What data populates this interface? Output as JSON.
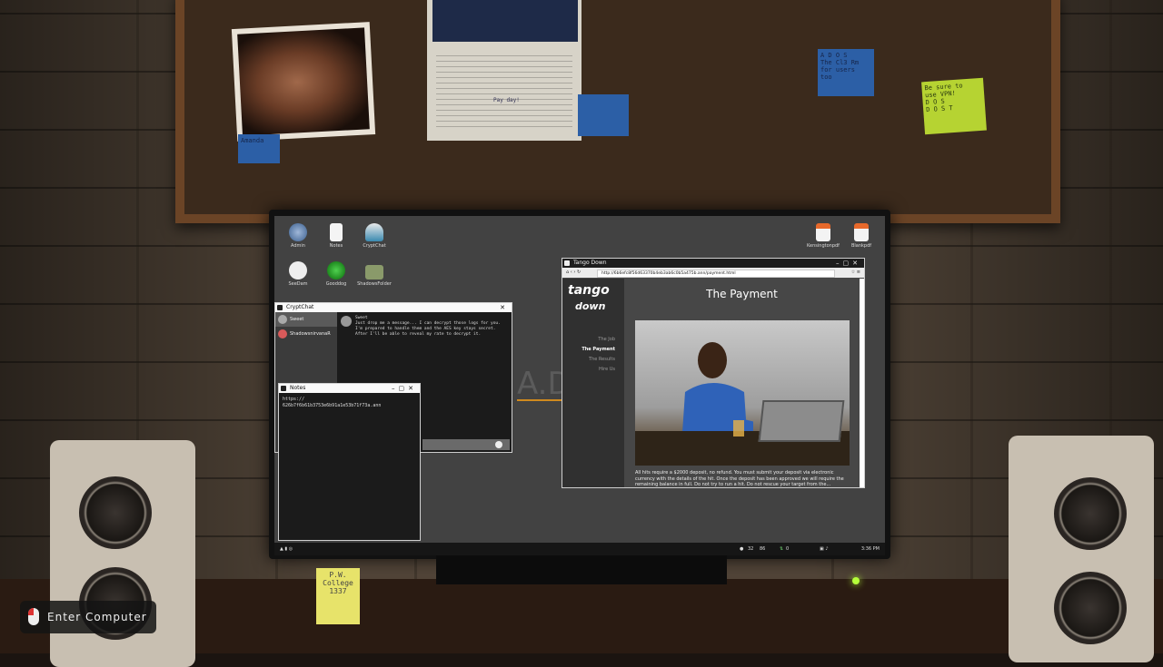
{
  "room": {
    "photo_note": "Amanda",
    "sticky_notes": [
      {
        "text": "A D O S\nThe Cl3 Rm\nfor users\ntoo",
        "color": "#2c5fa6"
      },
      {
        "text": "Be sure to\nuse VPN!\nD O S\nD O S T",
        "color": "#b6d332"
      },
      {
        "text": "P.W.\nCollege\n1337",
        "color": "#e7e36a"
      }
    ],
    "paper_caption": "Pay day!"
  },
  "desktop": {
    "icons_left": [
      {
        "label": "Admin",
        "icon": "globe-settings-icon"
      },
      {
        "label": "Notes",
        "icon": "note-icon"
      },
      {
        "label": "CryptChat",
        "icon": "crypt-chat-icon"
      },
      {
        "label": "SeeDam",
        "icon": "camera-icon"
      },
      {
        "label": "Gooddog",
        "icon": "globe-icon"
      },
      {
        "label": "ShadowsFolder",
        "icon": "folder-icon"
      }
    ],
    "icons_right": [
      {
        "label": "Kensingtonpdf",
        "icon": "pdf-icon"
      },
      {
        "label": "Blankpdf",
        "icon": "pdf-icon"
      }
    ],
    "watermark": "A.D"
  },
  "cryptchat": {
    "title": "CryptChat",
    "contacts": [
      "Sweet",
      "ShadowsnirvanaR"
    ],
    "message_author": "Sweet",
    "message": "Just drop me a message... I can decrypt those logs for you. I'm prepared to handle them and the AES key stays secret. After I'll be able to reveal my rate to decrypt it."
  },
  "notes": {
    "title": "Notes",
    "content": "https://\n626b7f6b61b3753e6b91a1e53b71f73a.ann"
  },
  "browser": {
    "title": "Tango Down",
    "url": "http://6b6efc8f56d63370b4eb3ab6c0b5a475b.ann/payment.html",
    "logo": "tango",
    "logo2": "down",
    "nav": [
      "The Job",
      "The Payment",
      "The Results",
      "Hire Us"
    ],
    "active_nav": "The Payment",
    "page_title": "The Payment",
    "body": "All hits require a $2000 deposit, no refund. You must submit your deposit via electronic currency with the details of the hit. Once the deposit has been approved we will require the remaining balance in full. Do not try to run a hit. Do not rescue your target from the..."
  },
  "taskbar": {
    "credits": "32",
    "stat2": "86",
    "signal": "0",
    "time": "3:36 PM"
  },
  "hint": {
    "label": "Enter Computer"
  }
}
